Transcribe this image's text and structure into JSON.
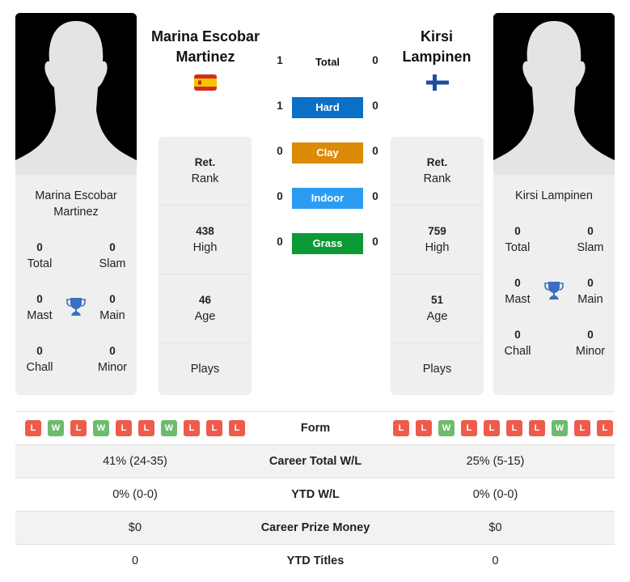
{
  "colors": {
    "hard": "#0970c6",
    "clay": "#dc8b07",
    "indoor": "#2b9cf2",
    "grass": "#0c9a37",
    "loss": "#ef5b4b",
    "win": "#6dbb6d",
    "trophy": "#3a6fc0"
  },
  "player1": {
    "name": "Marina Escobar Martinez",
    "name_line1": "Marina Escobar",
    "name_line2": "Martinez",
    "flag": "spain-flag",
    "titles": {
      "total": {
        "value": "0",
        "label": "Total"
      },
      "slam": {
        "value": "0",
        "label": "Slam"
      },
      "mast": {
        "value": "0",
        "label": "Mast"
      },
      "main": {
        "value": "0",
        "label": "Main"
      },
      "chall": {
        "value": "0",
        "label": "Chall"
      },
      "minor": {
        "value": "0",
        "label": "Minor"
      }
    },
    "info": {
      "rank": {
        "value": "Ret.",
        "label": "Rank"
      },
      "high": {
        "value": "438",
        "label": "High"
      },
      "age": {
        "value": "46",
        "label": "Age"
      },
      "plays": {
        "value": "",
        "label": "Plays"
      }
    },
    "form": [
      "L",
      "W",
      "L",
      "W",
      "L",
      "L",
      "W",
      "L",
      "L",
      "L"
    ]
  },
  "player2": {
    "name": "Kirsi Lampinen",
    "name_line1": "Kirsi",
    "name_line2": "Lampinen",
    "flag": "finland-flag",
    "titles": {
      "total": {
        "value": "0",
        "label": "Total"
      },
      "slam": {
        "value": "0",
        "label": "Slam"
      },
      "mast": {
        "value": "0",
        "label": "Mast"
      },
      "main": {
        "value": "0",
        "label": "Main"
      },
      "chall": {
        "value": "0",
        "label": "Chall"
      },
      "minor": {
        "value": "0",
        "label": "Minor"
      }
    },
    "info": {
      "rank": {
        "value": "Ret.",
        "label": "Rank"
      },
      "high": {
        "value": "759",
        "label": "High"
      },
      "age": {
        "value": "51",
        "label": "Age"
      },
      "plays": {
        "value": "",
        "label": "Plays"
      }
    },
    "form": [
      "L",
      "L",
      "W",
      "L",
      "L",
      "L",
      "L",
      "W",
      "L",
      "L"
    ]
  },
  "h2h": [
    {
      "label": "Total",
      "p1": "1",
      "p2": "0"
    },
    {
      "label": "Hard",
      "p1": "1",
      "p2": "0"
    },
    {
      "label": "Clay",
      "p1": "0",
      "p2": "0"
    },
    {
      "label": "Indoor",
      "p1": "0",
      "p2": "0"
    },
    {
      "label": "Grass",
      "p1": "0",
      "p2": "0"
    }
  ],
  "stats": [
    {
      "label": "Form",
      "p1": "",
      "p2": ""
    },
    {
      "label": "Career Total W/L",
      "p1": "41% (24-35)",
      "p2": "25% (5-15)"
    },
    {
      "label": "YTD W/L",
      "p1": "0% (0-0)",
      "p2": "0% (0-0)"
    },
    {
      "label": "Career Prize Money",
      "p1": "$0",
      "p2": "$0"
    },
    {
      "label": "YTD Titles",
      "p1": "0",
      "p2": "0"
    }
  ]
}
